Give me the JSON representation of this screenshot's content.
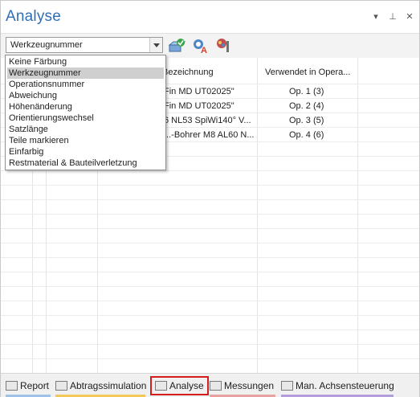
{
  "panel": {
    "title": "Analyse"
  },
  "window_buttons": {
    "menu": "▾",
    "pin": "⊥",
    "close": "✕"
  },
  "toolbar": {
    "color_mode_value": "Werkzeugnummer"
  },
  "dropdown": {
    "options": [
      "Keine Färbung",
      "Werkzeugnummer",
      "Operationsnummer",
      "Abweichung",
      "Höhenänderung",
      "Orientierungswechsel",
      "Satzlänge",
      "Teile markieren",
      "Einfarbig",
      "Restmaterial & Bauteilverletzung"
    ],
    "selected": "Werkzeugnummer"
  },
  "table": {
    "columns": [
      "Bezeichnung",
      "Verwendet in Opera..."
    ],
    "rows": [
      {
        "bezeichnung": "Fin MD UT02025\"",
        "verwendet": "Op. 1 (3)"
      },
      {
        "bezeichnung": "Fin MD UT02025\"",
        "verwendet": "Op. 2 (4)"
      },
      {
        "bezeichnung": "6 NL53 SpiWi140° V...",
        "verwendet": "Op. 3 (5)"
      },
      {
        "bezeichnung": "...-Bohrer M8 AL60 N...",
        "verwendet": "Op. 4 (6)"
      }
    ]
  },
  "tabs": [
    {
      "label": "Report",
      "accent": "#9fc3e6"
    },
    {
      "label": "Abtragssimulation",
      "accent": "#f2c85b"
    },
    {
      "label": "Analyse",
      "accent": "#d21e1e",
      "active": true
    },
    {
      "label": "Messungen",
      "accent": "#e7a2a2"
    },
    {
      "label": "Man. Achsensteuerung",
      "accent": "#b39ddb"
    }
  ],
  "colors": {
    "title": "#2e6fb7",
    "active_tab_border": "#d21e1e",
    "selected_option": "#cfcfcf"
  }
}
